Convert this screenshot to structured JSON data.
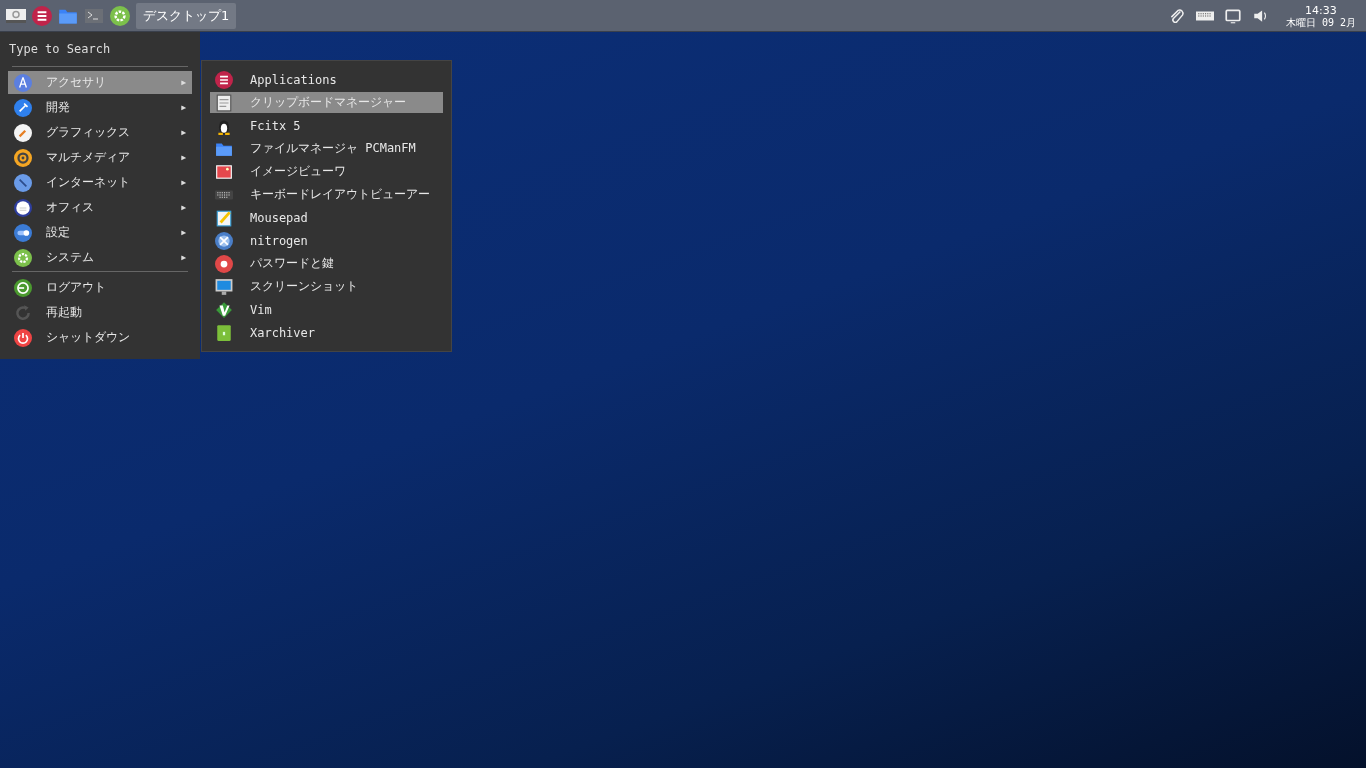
{
  "taskbar": {
    "workspace": "デスクトップ1",
    "clock": {
      "time": "14:33",
      "date": "木曜日 09 2月"
    }
  },
  "menu": {
    "search": {
      "placeholder": "Type to Search"
    },
    "categories": [
      {
        "label": "アクセサリ",
        "arrow": "▶",
        "selected": true
      },
      {
        "label": "開発",
        "arrow": "▶",
        "selected": false
      },
      {
        "label": "グラフィックス",
        "arrow": "▶",
        "selected": false
      },
      {
        "label": "マルチメディア",
        "arrow": "▶",
        "selected": false
      },
      {
        "label": "インターネット",
        "arrow": "▶",
        "selected": false
      },
      {
        "label": "オフィス",
        "arrow": "▶",
        "selected": false
      },
      {
        "label": "設定",
        "arrow": "▶",
        "selected": false
      },
      {
        "label": "システム",
        "arrow": "▶",
        "selected": false
      }
    ],
    "session": [
      {
        "label": "ログアウト"
      },
      {
        "label": "再起動"
      },
      {
        "label": "シャットダウン"
      }
    ]
  },
  "submenu": {
    "items": [
      {
        "label": "Applications",
        "selected": false
      },
      {
        "label": "クリップボードマネージャー",
        "selected": true
      },
      {
        "label": "Fcitx 5",
        "selected": false
      },
      {
        "label": "ファイルマネージャ PCManFM",
        "selected": false
      },
      {
        "label": "イメージビューワ",
        "selected": false
      },
      {
        "label": "キーボードレイアウトビューアー",
        "selected": false
      },
      {
        "label": "Mousepad",
        "selected": false
      },
      {
        "label": "nitrogen",
        "selected": false
      },
      {
        "label": "パスワードと鍵",
        "selected": false
      },
      {
        "label": "スクリーンショット",
        "selected": false
      },
      {
        "label": "Vim",
        "selected": false
      },
      {
        "label": "Xarchiver",
        "selected": false
      }
    ]
  }
}
